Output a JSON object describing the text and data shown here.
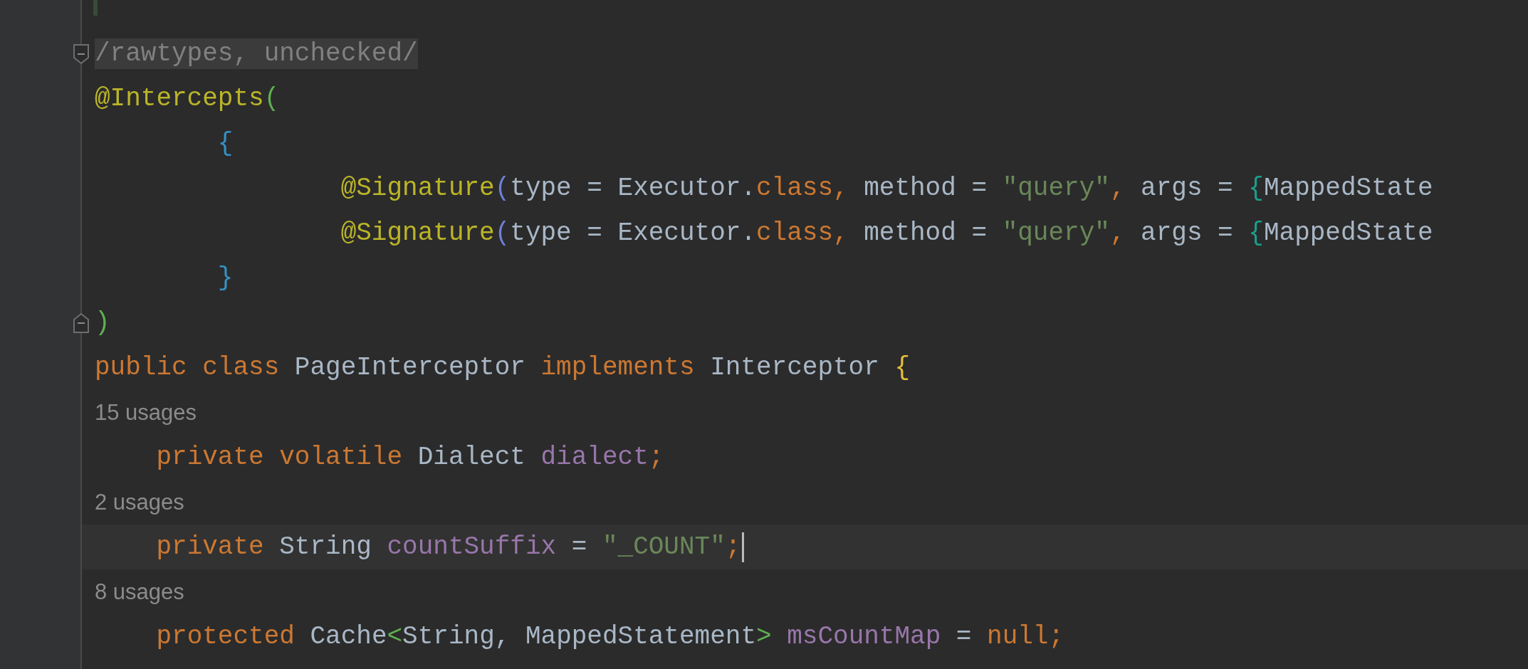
{
  "editor": {
    "lines": [
      {
        "kind": "code",
        "fold_start": true,
        "fold_end": false,
        "current": false,
        "shaded": true,
        "tokens": [
          {
            "text": "/rawtypes, unchecked/",
            "color": "#808080"
          }
        ]
      },
      {
        "kind": "code",
        "fold_start": false,
        "fold_end": false,
        "current": false,
        "shaded": false,
        "tokens": [
          {
            "text": "@Intercepts",
            "color": "#bbb529"
          },
          {
            "text": "(",
            "color": "#5eb050"
          }
        ]
      },
      {
        "kind": "code",
        "fold_start": false,
        "fold_end": false,
        "current": false,
        "shaded": false,
        "tokens": [
          {
            "text": "        {",
            "color": "#3592c4"
          }
        ]
      },
      {
        "kind": "code",
        "fold_start": false,
        "fold_end": false,
        "current": false,
        "shaded": false,
        "tokens": [
          {
            "text": "                @Signature",
            "color": "#bbb529"
          },
          {
            "text": "(",
            "color": "#6f7fd8"
          },
          {
            "text": "type = Executor.",
            "color": "#a9b7c6"
          },
          {
            "text": "class,",
            "color": "#cc7832"
          },
          {
            "text": " method = ",
            "color": "#a9b7c6"
          },
          {
            "text": "\"query\"",
            "color": "#6a8759"
          },
          {
            "text": ",",
            "color": "#cc7832"
          },
          {
            "text": " args = ",
            "color": "#a9b7c6"
          },
          {
            "text": "{",
            "color": "#1aa08e"
          },
          {
            "text": "MappedState",
            "color": "#a9b7c6"
          }
        ]
      },
      {
        "kind": "code",
        "fold_start": false,
        "fold_end": false,
        "current": false,
        "shaded": false,
        "tokens": [
          {
            "text": "                @Signature",
            "color": "#bbb529"
          },
          {
            "text": "(",
            "color": "#6f7fd8"
          },
          {
            "text": "type = Executor.",
            "color": "#a9b7c6"
          },
          {
            "text": "class,",
            "color": "#cc7832"
          },
          {
            "text": " method = ",
            "color": "#a9b7c6"
          },
          {
            "text": "\"query\"",
            "color": "#6a8759"
          },
          {
            "text": ",",
            "color": "#cc7832"
          },
          {
            "text": " args = ",
            "color": "#a9b7c6"
          },
          {
            "text": "{",
            "color": "#1aa08e"
          },
          {
            "text": "MappedState",
            "color": "#a9b7c6"
          }
        ]
      },
      {
        "kind": "code",
        "fold_start": false,
        "fold_end": false,
        "current": false,
        "shaded": false,
        "tokens": [
          {
            "text": "        }",
            "color": "#3592c4"
          }
        ]
      },
      {
        "kind": "code",
        "fold_start": false,
        "fold_end": true,
        "current": false,
        "shaded": false,
        "tokens": [
          {
            "text": ")",
            "color": "#5eb050"
          }
        ]
      },
      {
        "kind": "code",
        "fold_start": false,
        "fold_end": false,
        "current": false,
        "shaded": false,
        "tokens": [
          {
            "text": "public class ",
            "color": "#cc7832"
          },
          {
            "text": "PageInterceptor ",
            "color": "#a9b7c6"
          },
          {
            "text": "implements ",
            "color": "#cc7832"
          },
          {
            "text": "Interceptor ",
            "color": "#a9b7c6"
          },
          {
            "text": "{",
            "color": "#e8bf3a"
          }
        ]
      },
      {
        "kind": "usages",
        "fold_start": false,
        "fold_end": false,
        "current": false,
        "shaded": false,
        "tokens": [
          {
            "text": "15 usages",
            "color": "#8c8c8c"
          }
        ]
      },
      {
        "kind": "code",
        "fold_start": false,
        "fold_end": false,
        "current": false,
        "shaded": false,
        "tokens": [
          {
            "text": "    private volatile ",
            "color": "#cc7832"
          },
          {
            "text": "Dialect ",
            "color": "#a9b7c6"
          },
          {
            "text": "dialect",
            "color": "#9876aa"
          },
          {
            "text": ";",
            "color": "#cc7832"
          }
        ]
      },
      {
        "kind": "usages",
        "fold_start": false,
        "fold_end": false,
        "current": false,
        "shaded": false,
        "tokens": [
          {
            "text": "2 usages",
            "color": "#8c8c8c"
          }
        ]
      },
      {
        "kind": "code",
        "fold_start": false,
        "fold_end": false,
        "current": true,
        "shaded": false,
        "tokens": [
          {
            "text": "    private ",
            "color": "#cc7832"
          },
          {
            "text": "String ",
            "color": "#a9b7c6"
          },
          {
            "text": "countSuffix",
            "color": "#9876aa"
          },
          {
            "text": " = ",
            "color": "#a9b7c6"
          },
          {
            "text": "\"_COUNT\"",
            "color": "#6a8759"
          },
          {
            "text": ";",
            "color": "#cc7832"
          }
        ]
      },
      {
        "kind": "usages",
        "fold_start": false,
        "fold_end": false,
        "current": false,
        "shaded": false,
        "tokens": [
          {
            "text": "8 usages",
            "color": "#8c8c8c"
          }
        ]
      },
      {
        "kind": "code",
        "fold_start": false,
        "fold_end": false,
        "current": false,
        "shaded": false,
        "tokens": [
          {
            "text": "    protected ",
            "color": "#cc7832"
          },
          {
            "text": "Cache",
            "color": "#a9b7c6"
          },
          {
            "text": "<",
            "color": "#5eb050"
          },
          {
            "text": "String, MappedStatement",
            "color": "#a9b7c6"
          },
          {
            "text": ">",
            "color": "#5eb050"
          },
          {
            "text": " msCountMap",
            "color": "#9876aa"
          },
          {
            "text": " = ",
            "color": "#a9b7c6"
          },
          {
            "text": "null;",
            "color": "#cc7832"
          }
        ]
      }
    ]
  }
}
